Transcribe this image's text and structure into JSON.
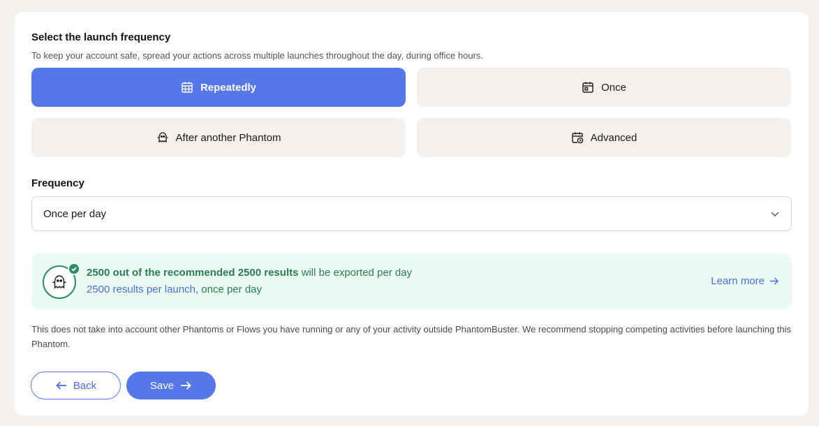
{
  "launch": {
    "title": "Select the launch frequency",
    "description": "To keep your account safe, spread your actions across multiple launches throughout the day, during office hours.",
    "options": [
      {
        "label": "Repeatedly",
        "icon": "calendar-grid-icon",
        "selected": true
      },
      {
        "label": "Once",
        "icon": "calendar-day-icon",
        "selected": false
      },
      {
        "label": "After another Phantom",
        "icon": "ghost-icon",
        "selected": false
      },
      {
        "label": "Advanced",
        "icon": "calendar-clock-icon",
        "selected": false
      }
    ]
  },
  "frequency": {
    "label": "Frequency",
    "value": "Once per day"
  },
  "info": {
    "bold": "2500 out of the recommended 2500 results",
    "rest": " will be exported per day",
    "link": "2500 results per launch",
    "suffix": ", once per day",
    "learn_more": "Learn more"
  },
  "note": "This does not take into account other Phantoms or Flows you have running or any of your activity outside PhantomBuster. We recommend stopping competing activities before launching this Phantom.",
  "buttons": {
    "back": "Back",
    "save": "Save"
  },
  "colors": {
    "accent": "#5577e8",
    "success": "#2e8c63",
    "info_bg": "#ecfaf4",
    "option_bg": "#f3f0ed"
  }
}
